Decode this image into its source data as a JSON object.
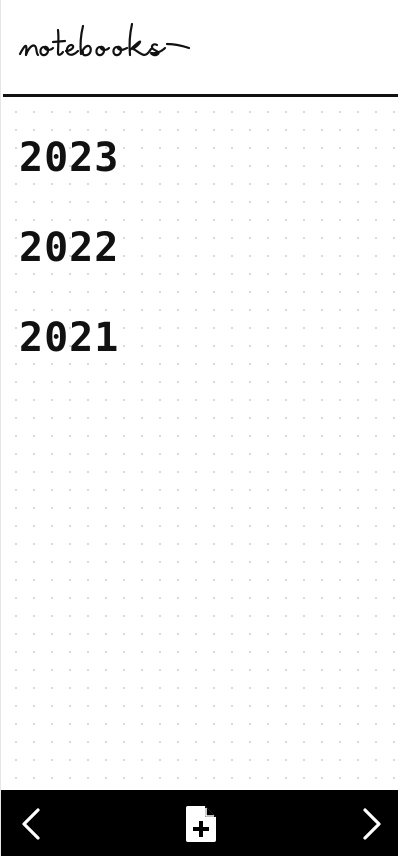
{
  "header": {
    "title": "notebooks"
  },
  "years": [
    "2023",
    "2022",
    "2021"
  ],
  "footer": {
    "prev_icon": "chevron-left-icon",
    "new_icon": "file-plus-icon",
    "next_icon": "chevron-right-icon"
  },
  "colors": {
    "ink": "#111111",
    "footer_bg": "#000000",
    "footer_icon": "#ffffff",
    "grid_dot": "#d3d3d3"
  }
}
